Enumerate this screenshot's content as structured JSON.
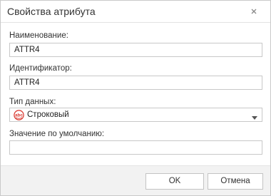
{
  "dialog": {
    "title": "Свойства атрибута",
    "close_icon": "close-icon"
  },
  "fields": {
    "name_label": "Наименование:",
    "name_value": "ATTR4",
    "id_label": "Идентификатор:",
    "id_value": "ATTR4",
    "type_label": "Тип данных:",
    "type_value": "Строковый",
    "type_icon": "abc-string-type-icon",
    "default_label": "Значение по умолчанию:",
    "default_value": ""
  },
  "buttons": {
    "ok_label": "OK",
    "cancel_label": "Отмена"
  },
  "colors": {
    "type_icon_red": "#d9342b",
    "border": "#c8c8c8",
    "footer_bg": "#f2f2f2"
  }
}
